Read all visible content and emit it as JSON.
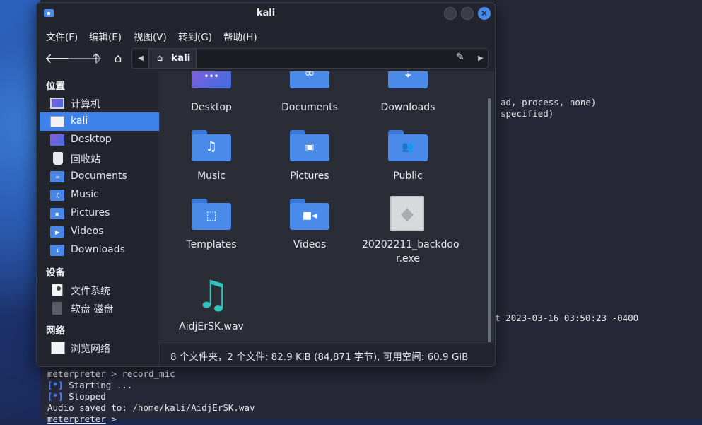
{
  "window": {
    "title": "kali"
  },
  "menubar": {
    "items": [
      "文件(F)",
      "编辑(E)",
      "视图(V)",
      "转到(G)",
      "帮助(H)"
    ]
  },
  "pathbar": {
    "crumb": "kali"
  },
  "sidebar": {
    "sections": [
      {
        "heading": "位置",
        "items": [
          {
            "label": "计算机",
            "icon": "computer-icon"
          },
          {
            "label": "kali",
            "icon": "home-folder-icon",
            "selected": true
          },
          {
            "label": "Desktop",
            "icon": "desktop-folder-icon"
          },
          {
            "label": "回收站",
            "icon": "trash-icon"
          },
          {
            "label": "Documents",
            "icon": "documents-folder-icon"
          },
          {
            "label": "Music",
            "icon": "music-folder-icon"
          },
          {
            "label": "Pictures",
            "icon": "pictures-folder-icon"
          },
          {
            "label": "Videos",
            "icon": "videos-folder-icon"
          },
          {
            "label": "Downloads",
            "icon": "downloads-folder-icon"
          }
        ]
      },
      {
        "heading": "设备",
        "items": [
          {
            "label": "文件系统",
            "icon": "filesystem-disk-icon"
          },
          {
            "label": "软盘 磁盘",
            "icon": "floppy-disk-icon"
          }
        ]
      },
      {
        "heading": "网络",
        "items": [
          {
            "label": "浏览网络",
            "icon": "network-icon"
          }
        ]
      }
    ]
  },
  "files": [
    {
      "name": "Desktop",
      "icon": "desktop-folder-icon"
    },
    {
      "name": "Documents",
      "icon": "documents-folder-icon"
    },
    {
      "name": "Downloads",
      "icon": "downloads-folder-icon"
    },
    {
      "name": "Music",
      "icon": "music-folder-icon"
    },
    {
      "name": "Pictures",
      "icon": "pictures-folder-icon"
    },
    {
      "name": "Public",
      "icon": "public-folder-icon"
    },
    {
      "name": "Templates",
      "icon": "templates-folder-icon"
    },
    {
      "name": "Videos",
      "icon": "videos-folder-icon"
    },
    {
      "name": "20202211_backdoo",
      "name_line2": "r.exe",
      "icon": "executable-icon"
    },
    {
      "name": "AidjErSK.wav",
      "icon": "audio-file-icon"
    }
  ],
  "status": {
    "text": "8 个文件夹，2 个文件: 82.9 KiB (84,871 字节), 可用空间: 60.9 GiB"
  },
  "terminal": {
    "line_a": "ad, process, none)",
    "line_b": "specified)",
    "line_c": "t 2023-03-16 03:50:23 -0400",
    "prompt": "meterpreter",
    "cmd": " > record_mic",
    "star1": "[*]",
    "msg1": " Starting ...",
    "star2": "[*]",
    "msg2": " Stopped",
    "saved": "Audio saved to: /home/kali/AidjErSK.wav",
    "prompt2": "meterpreter",
    "prompt2_tail": " >"
  },
  "colors": {
    "accent": "#3d82ea",
    "folder": "#4a8ae8",
    "window_bg": "#23252e",
    "content_bg": "#2a2c36"
  }
}
